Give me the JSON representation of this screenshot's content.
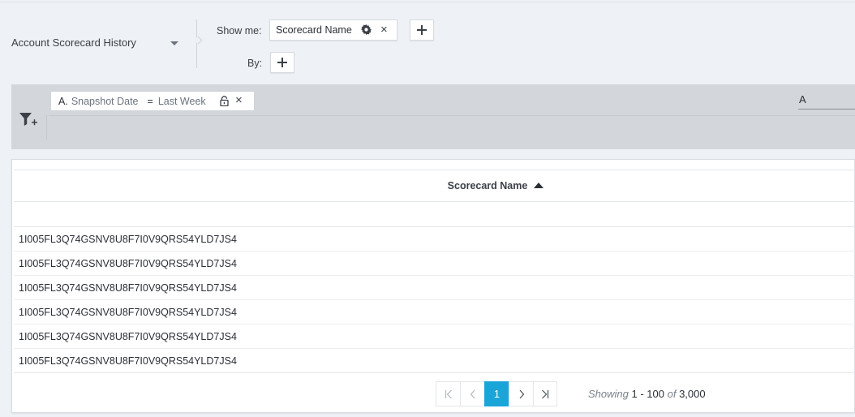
{
  "report": {
    "title": "Account Scorecard History"
  },
  "builder": {
    "show_label": "Show me:",
    "by_label": "By:",
    "show_fields": [
      {
        "label": "Scorecard Name"
      }
    ]
  },
  "filters": {
    "items": [
      {
        "letter": "A.",
        "field": "Snapshot Date",
        "operator": "=",
        "value": "Last Week"
      }
    ],
    "logic": "A"
  },
  "grid": {
    "columns": [
      {
        "label": "Scorecard Name",
        "sort": "ascending"
      }
    ],
    "rows": [
      "1I005FL3Q74GSNV8U8F7I0V9QRS54YLD7JS4",
      "1I005FL3Q74GSNV8U8F7I0V9QRS54YLD7JS4",
      "1I005FL3Q74GSNV8U8F7I0V9QRS54YLD7JS4",
      "1I005FL3Q74GSNV8U8F7I0V9QRS54YLD7JS4",
      "1I005FL3Q74GSNV8U8F7I0V9QRS54YLD7JS4",
      "1I005FL3Q74GSNV8U8F7I0V9QRS54YLD7JS4"
    ]
  },
  "pagination": {
    "current_page": "1",
    "showing_word": "Showing",
    "range": "1 - 100",
    "of_word": "of",
    "total": "3,000"
  },
  "colors": {
    "accent": "#1aa5d8",
    "page_bg": "#eef1f5",
    "filter_band": "#d3d6da"
  }
}
